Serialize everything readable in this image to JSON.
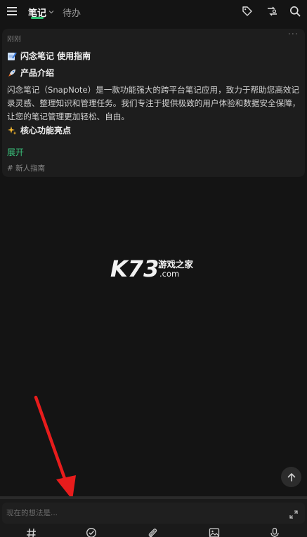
{
  "header": {
    "tabs": [
      {
        "label": "笔记",
        "active": true
      },
      {
        "label": "待办",
        "active": false
      }
    ],
    "icons": [
      "menu-icon",
      "tag-icon",
      "sync-icon",
      "search-icon"
    ]
  },
  "note": {
    "time": "刚刚",
    "more": "···",
    "title": "闪念笔记 使用指南",
    "section1": "产品介绍",
    "body": "闪念笔记（SnapNote）是一款功能强大的跨平台笔记应用，致力于帮助您高效记录灵感、整理知识和管理任务。我们专注于提供极致的用户体验和数据安全保障，让您的笔记管理更加轻松、自由。",
    "section2": "核心功能亮点",
    "expand": "展开",
    "tag": "# 新人指南"
  },
  "watermark": {
    "logo": "K73",
    "name": "游戏之家",
    "domain": ".com"
  },
  "composer": {
    "placeholder": "现在的想法是...",
    "toolbar": [
      "hashtag-icon",
      "todo-check-icon",
      "attachment-icon",
      "image-icon",
      "microphone-icon"
    ]
  },
  "colors": {
    "accent": "#2fbf71",
    "background": "#141414",
    "card": "#1d1d1d",
    "annotation": "#e81c1c"
  }
}
